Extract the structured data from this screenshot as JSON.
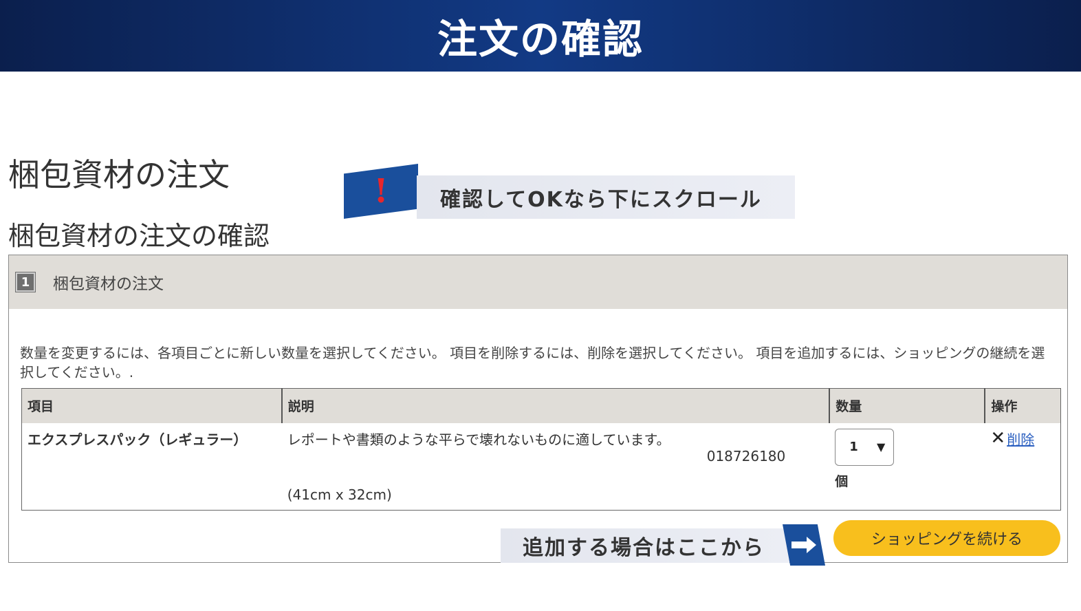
{
  "banner": {
    "title": "注文の確認"
  },
  "page": {
    "title": "梱包資材の注文",
    "subtitle": "梱包資材の注文の確認"
  },
  "callouts": {
    "top": {
      "mark": "!",
      "text": "確認してOKなら下にスクロール"
    },
    "bottom": {
      "text": "追加する場合はここから"
    }
  },
  "section": {
    "step_number": "1",
    "label": "梱包資材の注文",
    "instructions": "数量を変更するには、各項目ごとに新しい数量を選択してください。 項目を削除するには、削除を選択してください。 項目を追加するには、ショッピングの継続を選択してください。."
  },
  "table": {
    "headers": [
      "項目",
      "説明",
      "数量",
      "操作"
    ],
    "rows": [
      {
        "item": "エクスプレスパック（レギュラー）",
        "description": "レポートや書類のような平らで壊れないものに適しています。",
        "code": "018726180",
        "size": "(41cm x 32cm)",
        "quantity": "1",
        "unit": "個",
        "delete_label": "削除"
      }
    ]
  },
  "buttons": {
    "continue_shopping": "ショッピングを続ける"
  },
  "colors": {
    "banner": "#123a85",
    "callout_flag": "#1a4f9c",
    "alert_mark": "#e8262b",
    "continue_button": "#f8bf1d",
    "link": "#2a5fc0",
    "header_bg": "#e0ddd8"
  },
  "icons": {
    "delete": "close-icon",
    "callout_top": "exclamation-icon",
    "callout_bottom": "arrow-right-icon"
  }
}
